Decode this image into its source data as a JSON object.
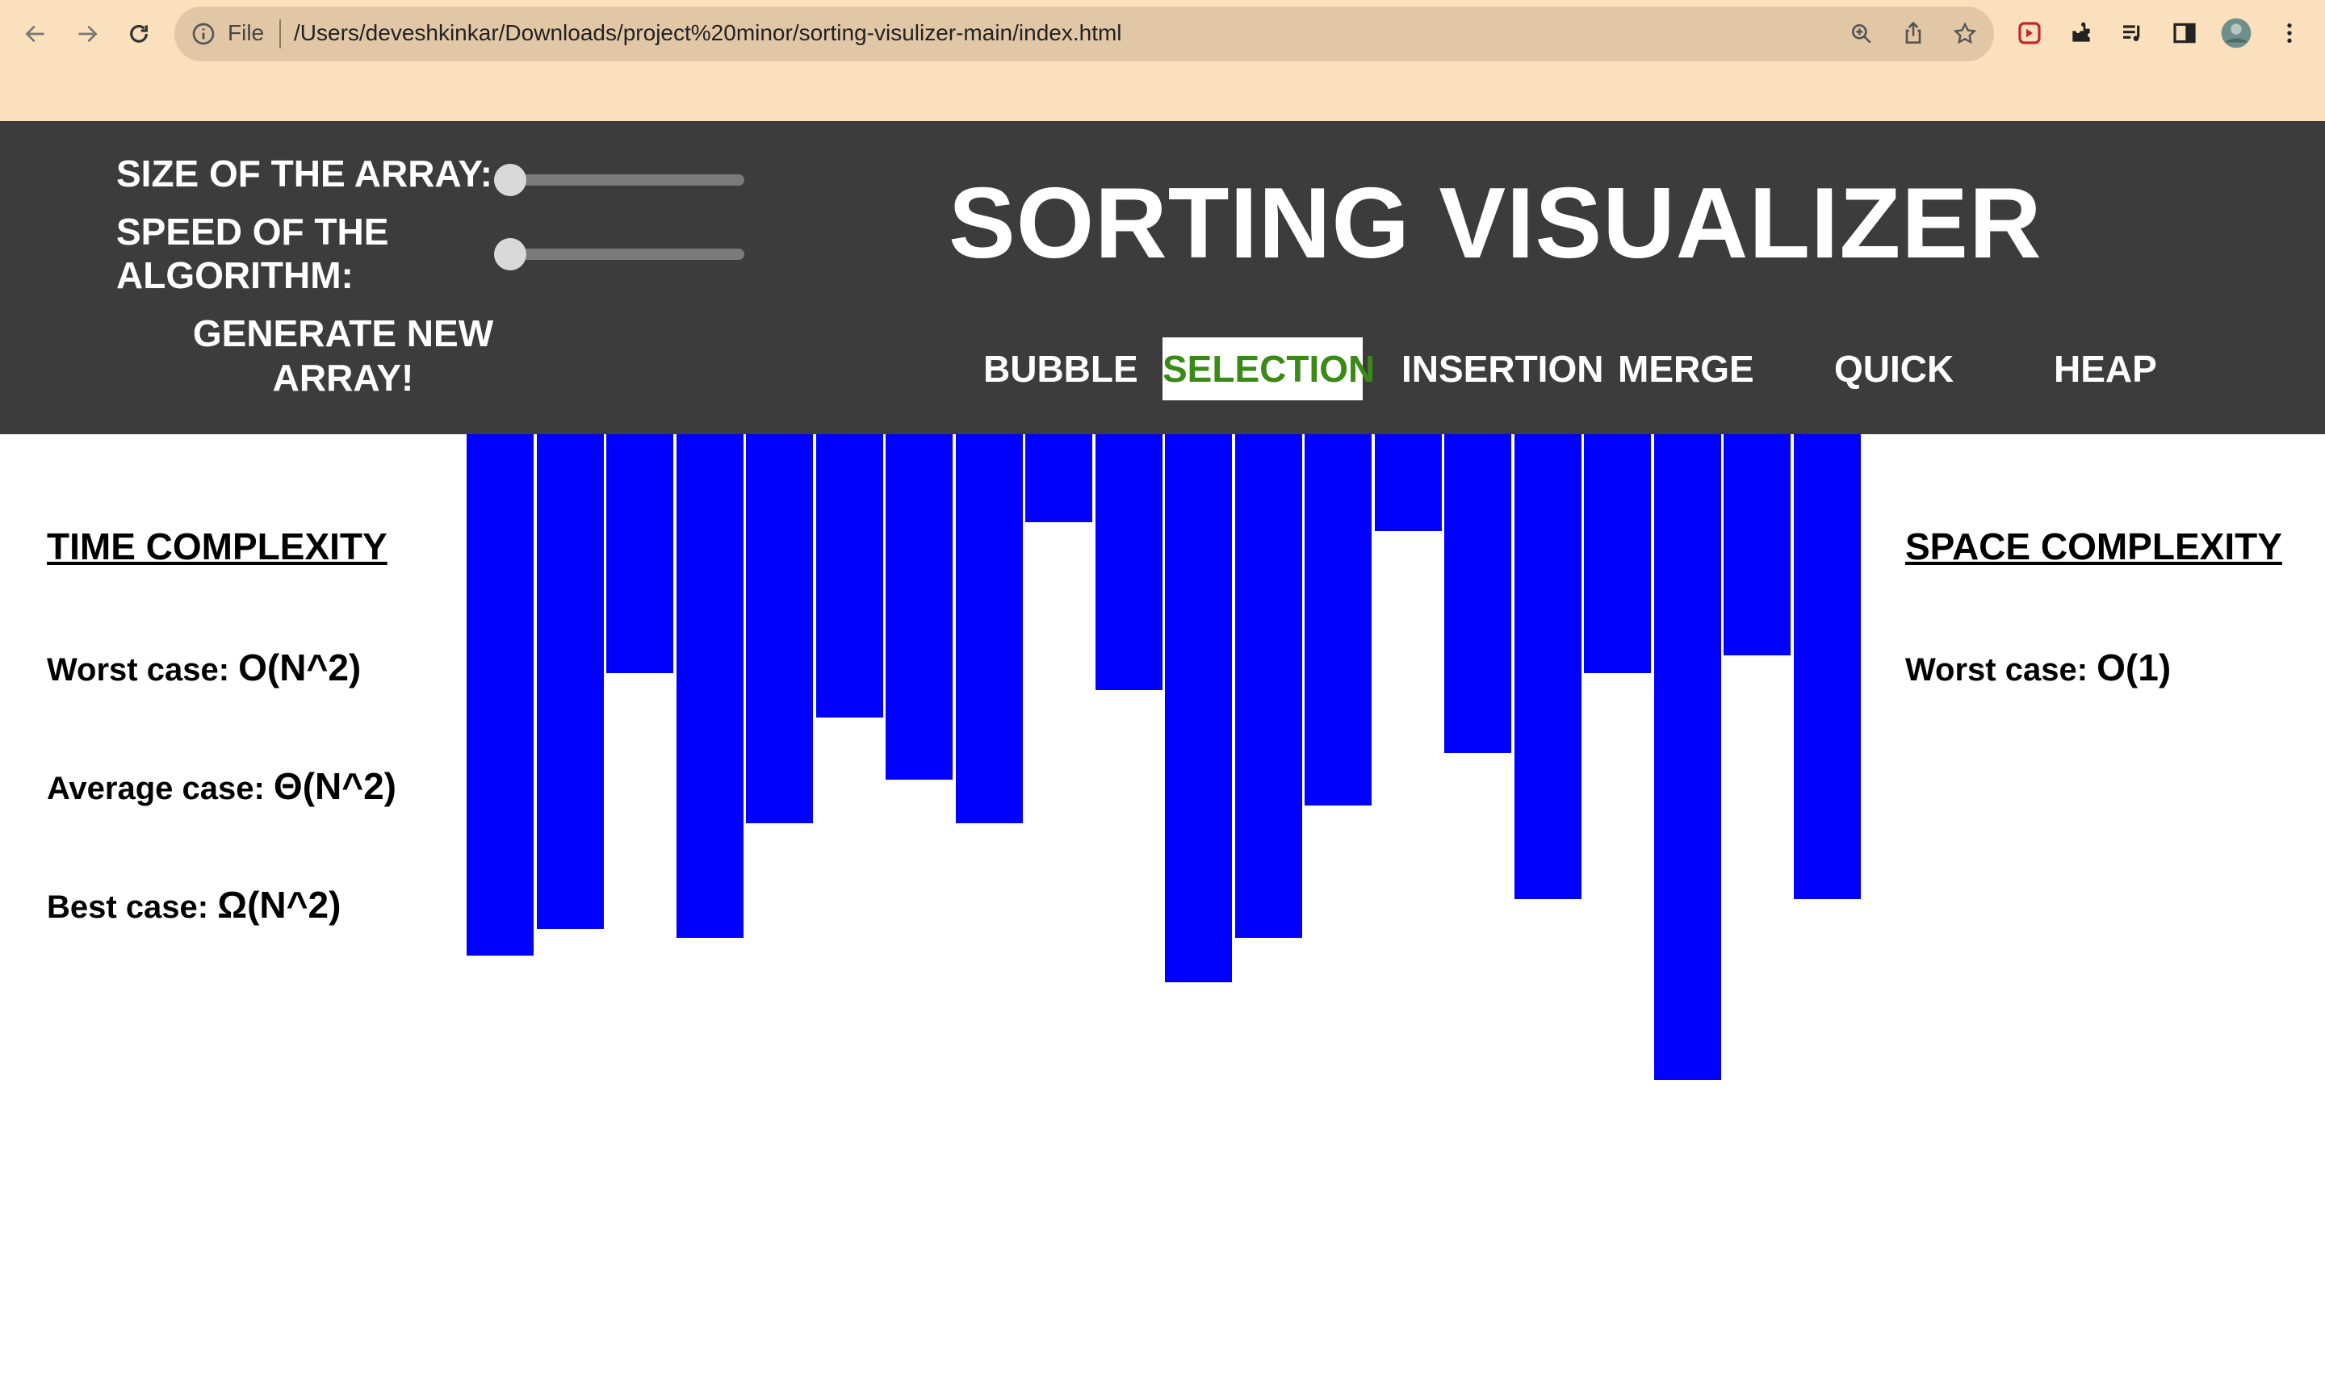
{
  "browser": {
    "file_label": "File",
    "url": "/Users/deveshkinkar/Downloads/project%20minor/sorting-visulizer-main/index.html"
  },
  "controls": {
    "size_label": "SIZE OF THE ARRAY:",
    "speed_label_line1": "SPEED OF THE",
    "speed_label_line2": "ALGORITHM:",
    "generate_line1": "GENERATE NEW",
    "generate_line2": "ARRAY!",
    "size_slider_value": 0,
    "speed_slider_value": 0
  },
  "title": "SORTING VISUALIZER",
  "algorithms": [
    "BUBBLE",
    "SELECTION",
    "INSERTION",
    "MERGE",
    "QUICK",
    "HEAP"
  ],
  "active_algorithm": "SELECTION",
  "time_complexity": {
    "heading": "TIME COMPLEXITY",
    "worst_label": "Worst case: ",
    "worst_value": "O(N^2)",
    "average_label": "Average case: ",
    "average_value": "Θ(N^2)",
    "best_label": "Best case: ",
    "best_value": "Ω(N^2)"
  },
  "space_complexity": {
    "heading": "SPACE COMPLEXITY",
    "worst_label": "Worst case: ",
    "worst_value": "O(1)"
  },
  "colors": {
    "bar": "#0000ff",
    "header_bg": "#3c3c3c",
    "active_algo_text": "#3a8a16",
    "browser_bg": "#fbe0bd"
  },
  "array_values": [
    64.6,
    61.3,
    29.6,
    62.4,
    48.2,
    35.1,
    42.8,
    48.2,
    10.9,
    31.7,
    67.9,
    62.4,
    46.0,
    12.0,
    39.5,
    57.6,
    29.6,
    80.0,
    27.4,
    57.6
  ]
}
